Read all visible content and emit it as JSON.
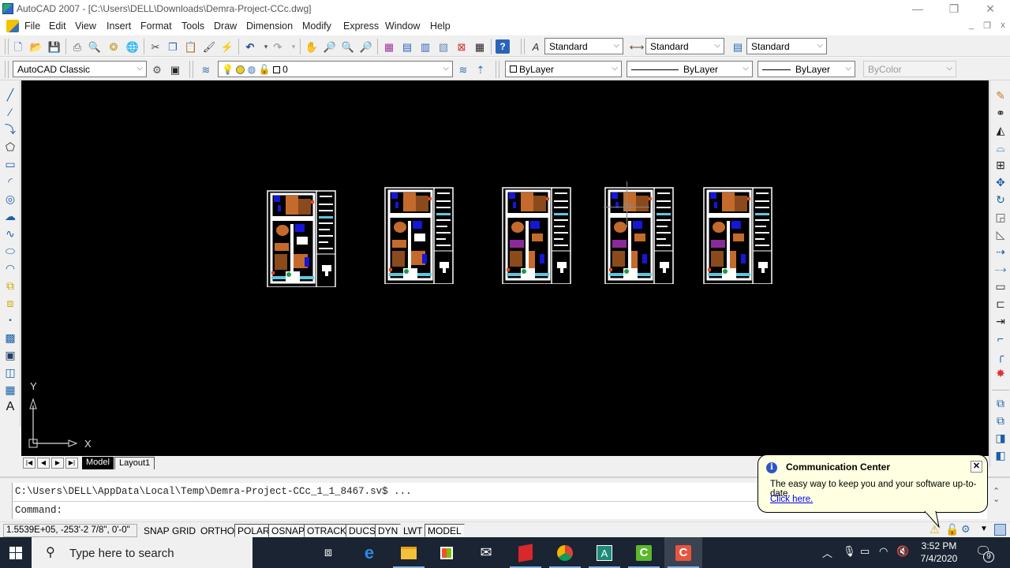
{
  "window": {
    "title": "AutoCAD 2007 - [C:\\Users\\DELL\\Downloads\\Demra-Project-CCc.dwg]",
    "controls": {
      "minimize": "—",
      "restore": "❐",
      "close": "✕"
    },
    "mdi_controls": {
      "minimize": "_",
      "restore": "❐",
      "close": "x"
    }
  },
  "menu": {
    "items": [
      "File",
      "Edit",
      "View",
      "Insert",
      "Format",
      "Tools",
      "Draw",
      "Dimension",
      "Modify",
      "Express",
      "Window",
      "Help"
    ]
  },
  "standard_toolbar": {
    "icons": [
      "new-icon",
      "open-icon",
      "save-icon",
      "plot-icon",
      "plot-preview-icon",
      "publish-icon",
      "3d-dwf-icon",
      "cut-icon",
      "copy-icon",
      "paste-icon",
      "match-properties-icon",
      "block-editor-icon",
      "undo-icon",
      "redo-icon",
      "pan-icon",
      "zoom-realtime-icon",
      "zoom-window-icon",
      "zoom-previous-icon",
      "properties-icon",
      "design-center-icon",
      "tool-palettes-icon",
      "sheet-set-icon",
      "markup-icon",
      "quickcalc-icon",
      "help-icon"
    ]
  },
  "styles_toolbar": {
    "text_style": "Standard",
    "dim_style": "Standard",
    "table_style": "Standard"
  },
  "workspace": {
    "value": "AutoCAD Classic"
  },
  "layers": {
    "current_layer": "0"
  },
  "properties": {
    "color": "ByLayer",
    "linetype": "ByLayer",
    "lineweight": "ByLayer",
    "plot_style": "ByColor"
  },
  "draw_toolbar": {
    "icons": [
      "line-icon",
      "construction-line-icon",
      "polyline-icon",
      "polygon-icon",
      "rectangle-icon",
      "arc-icon",
      "circle-icon",
      "revision-cloud-icon",
      "spline-icon",
      "ellipse-icon",
      "ellipse-arc-icon",
      "insert-block-icon",
      "make-block-icon",
      "point-icon",
      "hatch-icon",
      "gradient-icon",
      "region-icon",
      "table-icon",
      "multiline-text-icon"
    ]
  },
  "modify_toolbar": {
    "icons": [
      "erase-icon",
      "copy-object-icon",
      "mirror-icon",
      "offset-icon",
      "array-icon",
      "move-icon",
      "rotate-icon",
      "scale-icon",
      "stretch-icon",
      "trim-icon",
      "extend-icon",
      "break-at-point-icon",
      "break-icon",
      "join-icon",
      "chamfer-icon",
      "fillet-icon",
      "explode-icon"
    ]
  },
  "draw_order_toolbar": {
    "icons": [
      "bring-to-front-icon",
      "send-to-back-icon",
      "bring-above-icon",
      "send-under-icon"
    ]
  },
  "canvas": {
    "ucs": {
      "x_label": "X",
      "y_label": "Y"
    },
    "sheets_count": 5
  },
  "layout_tabs": {
    "nav": [
      "|◀",
      "◀",
      "▶",
      "▶|"
    ],
    "tabs": [
      "Model",
      "Layout1"
    ],
    "active": "Model"
  },
  "command_line": {
    "history": "C:\\Users\\DELL\\AppData\\Local\\Temp\\Demra-Project-CCc_1_1_8467.sv$ ...",
    "prompt": "Command:"
  },
  "status_bar": {
    "coordinates": "1.5539E+05, -253'-2 7/8\", 0'-0\"",
    "toggles": [
      {
        "label": "SNAP",
        "on": false
      },
      {
        "label": "GRID",
        "on": false
      },
      {
        "label": "ORTHO",
        "on": false
      },
      {
        "label": "POLAR",
        "on": true
      },
      {
        "label": "OSNAP",
        "on": true
      },
      {
        "label": "OTRACK",
        "on": true
      },
      {
        "label": "DUCS",
        "on": true
      },
      {
        "label": "DYN",
        "on": true
      },
      {
        "label": "LWT",
        "on": false
      },
      {
        "label": "MODEL",
        "on": true
      }
    ]
  },
  "balloon": {
    "title": "Communication Center",
    "text": "The easy way to keep you and your software up-to-date.",
    "link": "Click here.",
    "close": "✕"
  },
  "taskbar": {
    "search_placeholder": "Type here to search",
    "apps": [
      "task-view",
      "edge",
      "file-explorer",
      "store",
      "mail",
      "sketchup",
      "chrome",
      "autocad",
      "camtasia-green",
      "camtasia-red"
    ],
    "time": "3:52 PM",
    "date": "7/4/2020",
    "notification_count": "9"
  },
  "colors": {
    "canvas_bg": "#000000",
    "balloon_bg": "#ffffe1",
    "taskbar_bg": "#1a2433",
    "link": "#0000ff"
  }
}
